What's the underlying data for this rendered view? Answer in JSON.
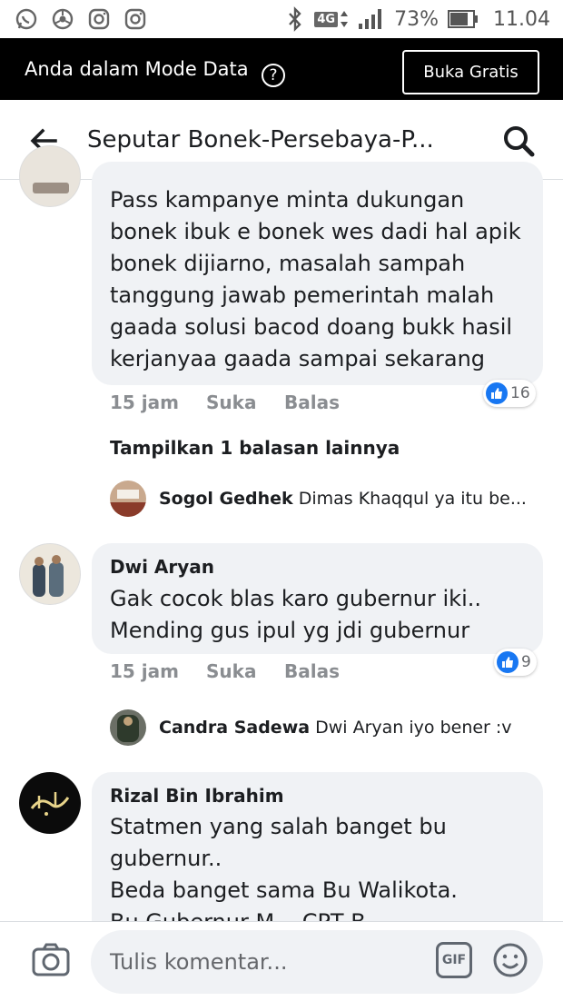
{
  "status_bar": {
    "network": "4G",
    "battery": "73%",
    "time": "11.04"
  },
  "data_banner": {
    "text": "Anda dalam Mode Data",
    "help": "?",
    "button": "Buka Gratis"
  },
  "header": {
    "title": "Seputar Bonek-Persebaya-P..."
  },
  "comments": [
    {
      "lines": [
        "Pass kampanye minta dukungan",
        "bonek ibuk e bonek wes dadi hal apik",
        "bonek dijiarno, masalah sampah",
        "tanggung jawab pemerintah malah",
        "gaada solusi bacod doang bukk hasil",
        "kerjanyaa gaada sampai sekarang"
      ],
      "time": "15 jam",
      "like": "Suka",
      "reply": "Balas",
      "reactions": "16"
    },
    {
      "name": "Dwi Aryan",
      "lines": [
        "Gak cocok blas karo gubernur iki..",
        "Mending gus ipul yg jdi gubernur"
      ],
      "time": "15 jam",
      "like": "Suka",
      "reply": "Balas",
      "reactions": "9"
    },
    {
      "name": "Rizal Bin Ibrahim",
      "lines": [
        "Statmen yang salah banget bu",
        "gubernur..",
        "Beda banget sama Bu Walikota.",
        "Bu Gubernur M... CPT B..."
      ]
    }
  ],
  "more_replies": "Tampilkan 1 balasan lainnya",
  "replies": [
    {
      "name": "Sogol Gedhek",
      "text": "Dimas Khaqqul ya itu be..."
    },
    {
      "name": "Candra Sadewa",
      "text": "Dwi Aryan iyo bener :v"
    }
  ],
  "composer": {
    "placeholder": "Tulis komentar...",
    "gif": "GIF"
  },
  "colors": {
    "like_blue": "#1877f2",
    "bubble_bg": "#f0f2f5",
    "meta_gray": "#8a8d91"
  },
  "icons": [
    "whatsapp-icon",
    "chrome-icon",
    "instagram-icon",
    "instagram-icon",
    "bluetooth-icon",
    "signal-icon",
    "battery-icon",
    "help-icon",
    "back-arrow-icon",
    "search-icon",
    "like-icon",
    "camera-icon",
    "gif-icon",
    "emoji-icon"
  ]
}
